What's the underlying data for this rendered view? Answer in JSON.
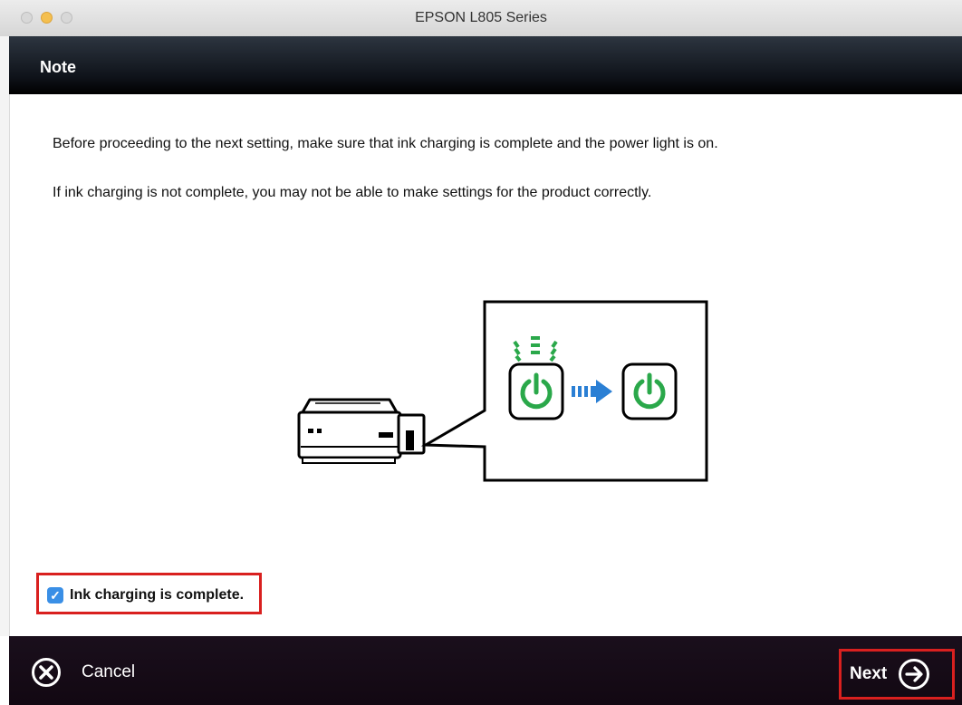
{
  "window": {
    "title": "EPSON L805 Series"
  },
  "header": {
    "title": "Note"
  },
  "body": {
    "paragraph_1": "Before proceeding to the next setting, make sure that ink charging is complete and the power light is on.",
    "paragraph_2": "If ink charging is not complete, you may not be able to make settings for the product correctly."
  },
  "illustration": {
    "icons": [
      "printer-icon",
      "power-light-flashing-icon",
      "arrow-right-icon",
      "power-light-on-icon"
    ],
    "colors": {
      "power_green": "#2aa84a",
      "arrow_blue": "#2a7fd4"
    }
  },
  "checkbox": {
    "label": "Ink charging is complete.",
    "checked": true,
    "check_glyph": "✓"
  },
  "footer": {
    "cancel_label": "Cancel",
    "next_label": "Next"
  },
  "colors": {
    "highlight": "#d9201f",
    "checkbox_blue": "#3a8fe6"
  }
}
